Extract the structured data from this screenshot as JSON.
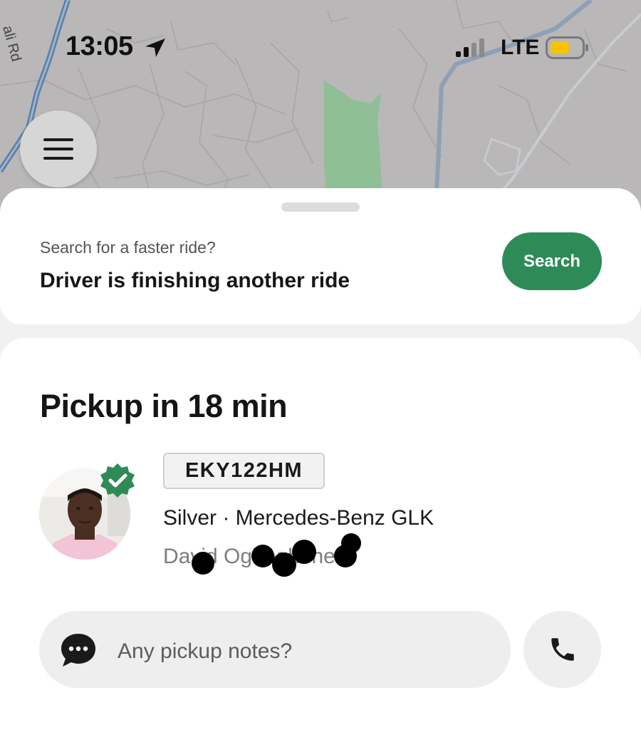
{
  "status_bar": {
    "time": "13:05",
    "network": "LTE",
    "battery_color": "#f5c400"
  },
  "map": {
    "street_label": "ali Rd",
    "park_color": "#8fbf94",
    "road_color": "#5b7fa6"
  },
  "menu": {
    "icon": "hamburger-menu-icon"
  },
  "ride_prompt": {
    "hint": "Search for a faster ride?",
    "status": "Driver is finishing another ride",
    "search_label": "Search",
    "accent": "#2e8b57"
  },
  "pickup": {
    "title": "Pickup in 18 min",
    "plate": "EKY122HM",
    "vehicle": "Silver · Mercedes-Benz GLK",
    "driver_name": "David Oghoghene",
    "verified_icon": "verified-badge-icon"
  },
  "notes": {
    "placeholder": "Any pickup notes?",
    "icon": "chat-bubble-icon"
  },
  "call": {
    "icon": "phone-icon"
  }
}
